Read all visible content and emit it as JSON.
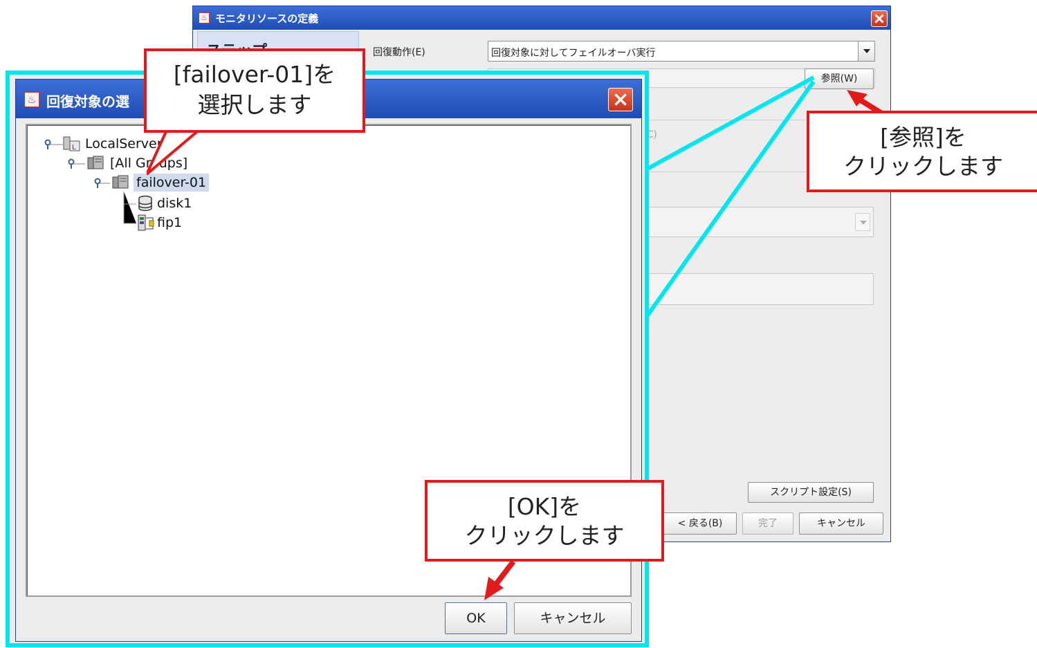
{
  "back_window": {
    "title": "モニタリソースの定義",
    "sidebar_heading": "ステップ",
    "recovery_action_label": "回復動作(E)",
    "recovery_action_value": "回復対象に対してフェイルオーバ実行",
    "browse_button": "参照(W)",
    "disabled_option": "(C)",
    "script_settings_button": "スクリプト設定(S)",
    "back_button": "< 戻る(B)",
    "finish_button": "完了",
    "cancel_button": "キャンセル"
  },
  "dialog": {
    "title": "回復対象の選",
    "tree": [
      {
        "label": "LocalServer"
      },
      {
        "label": "[All Groups]"
      },
      {
        "label": "failover-01",
        "selected": true
      },
      {
        "label": "disk1"
      },
      {
        "label": "fip1"
      }
    ],
    "ok_button": "OK",
    "cancel_button": "キャンセル"
  },
  "callouts": {
    "select": [
      "[failover-01]を",
      "選択します"
    ],
    "browse": [
      "[参照]を",
      "クリックします"
    ],
    "ok": [
      "[OK]を",
      "クリックします"
    ]
  },
  "colors": {
    "callout_border": "#e11b1b",
    "arrow": "#e11b1b",
    "highlight_frame": "#00e5ee",
    "titlebar": "#1f4cb5"
  }
}
